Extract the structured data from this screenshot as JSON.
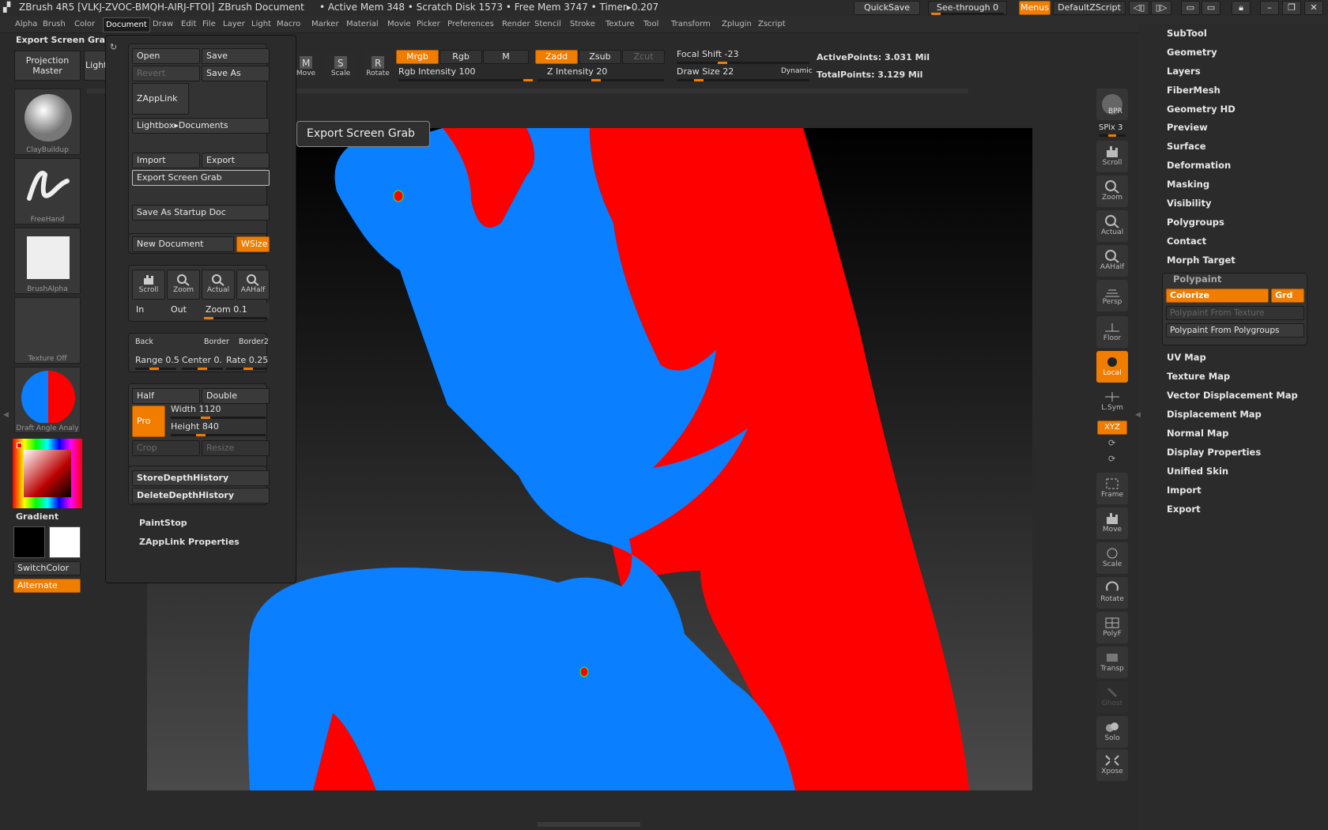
{
  "titlebar": {
    "app": "ZBrush 4R5 [VLKJ-ZVOC-BMQH-AIRJ-FTOI]",
    "doc": "ZBrush Document",
    "mem": "• Active Mem 348 • Scratch Disk 1573 • Free Mem 3747 • Timer▸0.207",
    "quicksave": "QuickSave",
    "seethrough": "See-through 0",
    "menus": "Menus",
    "script": "DefaultZScript"
  },
  "menubar": [
    "Alpha",
    "Brush",
    "Color",
    "Document",
    "Draw",
    "Edit",
    "File",
    "Layer",
    "Light",
    "Macro",
    "Marker",
    "Material",
    "Movie",
    "Picker",
    "Preferences",
    "Render",
    "Stencil",
    "Stroke",
    "Texture",
    "Tool",
    "Transform",
    "Zplugin",
    "Zscript"
  ],
  "shelf": {
    "export_label": "Export Screen Grab",
    "projection": "Projection Master",
    "lightbox": "LightBox",
    "move": "Move",
    "scale": "Scale",
    "rotate": "Rotate",
    "mrgb": "Mrgb",
    "rgb": "Rgb",
    "m": "M",
    "zadd": "Zadd",
    "zsub": "Zsub",
    "zcut": "Zcut",
    "rgb_int": "Rgb Intensity 100",
    "z_int": "Z Intensity 20",
    "focal": "Focal Shift -23",
    "draw": "Draw Size 22",
    "dynamic": "Dynamic",
    "active": "ActivePoints: 3.031 Mil",
    "total": "TotalPoints: 3.129 Mil"
  },
  "left": {
    "clay": "ClayBuildup",
    "freehand": "FreeHand",
    "alpha": "BrushAlpha",
    "texture": "Texture Off",
    "material": "Draft Angle Analy",
    "gradient": "Gradient",
    "switch": "SwitchColor",
    "alternate": "Alternate"
  },
  "doc": {
    "open": "Open",
    "save": "Save",
    "revert": "Revert",
    "saveas": "Save As",
    "zapplink": "ZAppLink",
    "lightbox": "Lightbox▸Documents",
    "import": "Import",
    "export": "Export",
    "grab": "Export Screen Grab",
    "startup": "Save As Startup Doc",
    "newdoc": "New Document",
    "wsize": "WSize",
    "scroll": "Scroll",
    "zoom": "Zoom",
    "actual": "Actual",
    "aahalf": "AAHalf",
    "in": "In",
    "out": "Out",
    "zoomval": "Zoom 0.1",
    "back": "Back",
    "border": "Border",
    "border2": "Border2",
    "range": "Range 0.5",
    "center": "Center 0.",
    "rate": "Rate 0.25",
    "half": "Half",
    "double": "Double",
    "pro": "Pro",
    "width": "Width 1120",
    "height": "Height 840",
    "crop": "Crop",
    "resize": "Resize",
    "store": "StoreDepthHistory",
    "delete": "DeleteDepthHistory",
    "paintstop": "PaintStop",
    "zprops": "ZAppLink Properties"
  },
  "tooltip": "Export Screen Grab",
  "right": {
    "bpr": "BPR",
    "spix": "SPix 3",
    "scroll": "Scroll",
    "zoom": "Zoom",
    "actual": "Actual",
    "aahalf": "AAHalf",
    "persp": "Persp",
    "floor": "Floor",
    "local": "Local",
    "lsym": "L.Sym",
    "xyz": "XYZ",
    "frame": "Frame",
    "move": "Move",
    "scale": "Scale",
    "rotate": "Rotate",
    "polyf": "PolyF",
    "transp": "Transp",
    "ghost": "Ghost",
    "solo": "Solo",
    "xpose": "Xpose"
  },
  "tray": {
    "items_top": [
      "SubTool",
      "Geometry",
      "Layers",
      "FiberMesh",
      "Geometry HD",
      "Preview",
      "Surface",
      "Deformation",
      "Masking",
      "Visibility",
      "Polygroups",
      "Contact",
      "Morph Target"
    ],
    "polypaint": "Polypaint",
    "colorize": "Colorize",
    "grd": "Grd",
    "from_texture": "Polypaint From Texture",
    "from_poly": "Polypaint From Polygroups",
    "items_bottom": [
      "UV Map",
      "Texture Map",
      "Vector Displacement Map",
      "Displacement Map",
      "Normal Map",
      "Display Properties",
      "Unified Skin",
      "Import",
      "Export"
    ]
  },
  "colors": {
    "accent": "#f07c00",
    "red": "#ff0000",
    "blue": "#0a7fff"
  }
}
